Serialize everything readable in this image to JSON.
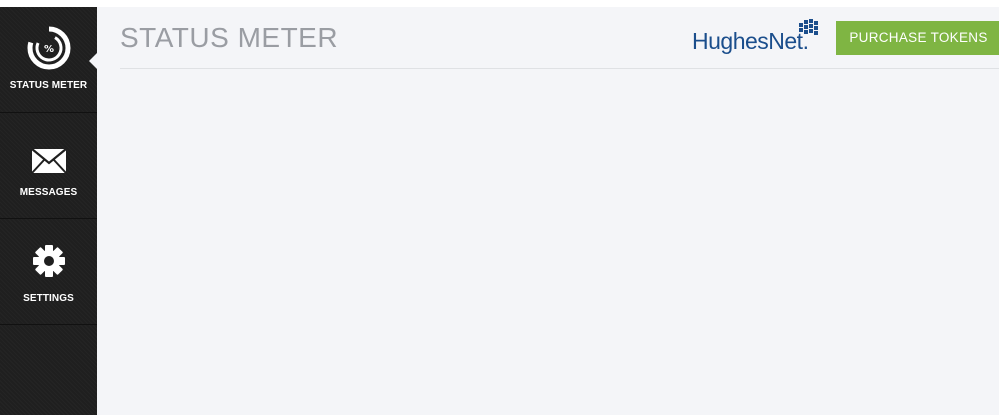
{
  "sidebar": {
    "items": [
      {
        "label": "STATUS METER",
        "icon": "status-meter-icon",
        "active": true
      },
      {
        "label": "MESSAGES",
        "icon": "envelope-icon",
        "active": false
      },
      {
        "label": "SETTINGS",
        "icon": "gear-icon",
        "active": false
      }
    ]
  },
  "header": {
    "title": "STATUS METER",
    "brand": "HughesNet",
    "brand_suffix": ".",
    "purchase_label": "PURCHASE TOKENS"
  },
  "status_icon_symbol": "%",
  "colors": {
    "sidebar_bg": "#1f1f1f",
    "page_bg": "#f4f5f8",
    "title_text": "#9a9da3",
    "brand_blue": "#1b4e8c",
    "accent_green": "#7fb543"
  }
}
